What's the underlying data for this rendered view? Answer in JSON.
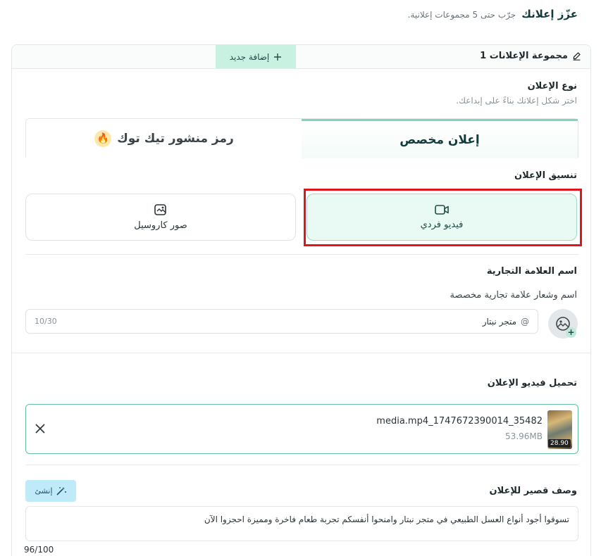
{
  "header": {
    "title": "عزّز إعلانك",
    "subtitle": "جرّب حتى 5 مجموعات إعلانية."
  },
  "group": {
    "title": "مجموعة الإعلانات 1",
    "add_label": "إضافة جديد"
  },
  "ad_type": {
    "label": "نوع الإعلان",
    "hint": "اختر شكل إعلانك بناءً على إبداعك.",
    "tabs": [
      {
        "label": "إعلان مخصص",
        "active": true
      },
      {
        "label": "رمز منشور تيك توك",
        "active": false,
        "icon": "fire-icon"
      }
    ]
  },
  "format": {
    "label": "تنسيق الإعلان",
    "options": [
      {
        "label": "فيديو فردي",
        "icon": "video-icon",
        "selected": true
      },
      {
        "label": "صور كاروسيل",
        "icon": "carousel-icon",
        "selected": false
      }
    ]
  },
  "brand": {
    "label": "اسم العلامة التجارية",
    "hint": "اسم وشعار علامة تجارية مخصصة",
    "at": "@",
    "value": "متجر نبتار",
    "count": "10/30"
  },
  "video": {
    "label": "تحميل فيديو الإعلان",
    "file_name": "media.mp4_1747672390014_35482",
    "file_size": "53.96MB",
    "duration": "28.90"
  },
  "description": {
    "label": "وصف قصير للإعلان",
    "generate_label": "إنشئ",
    "value": "تسوقوا أجود أنواع العسل الطبيعي في متجر نبتار وامنحوا أنفسكم تجربة طعام فاخرة ومميزة احجزوا الآن",
    "count": "96/100"
  },
  "colors": {
    "accent": "#7fd6bd",
    "selected_bg": "#e9f9f3",
    "highlight": "#e0161f",
    "title": "#123b3c"
  }
}
